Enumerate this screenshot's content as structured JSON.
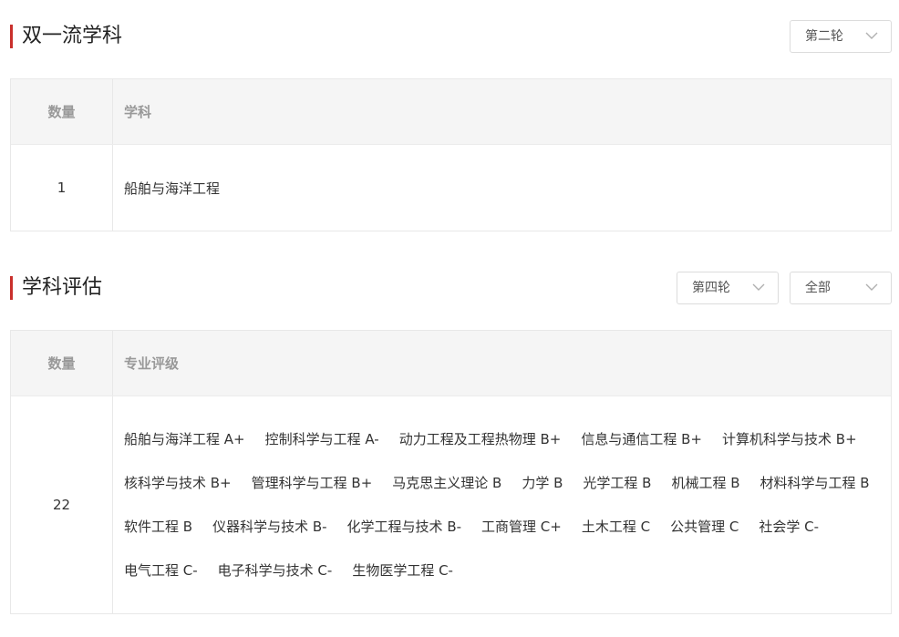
{
  "double_first_class": {
    "title": "双一流学科",
    "round_select": "第二轮",
    "headers": {
      "count": "数量",
      "subject": "学科"
    },
    "row": {
      "count": "1",
      "subject": "船舶与海洋工程"
    }
  },
  "evaluation": {
    "title": "学科评估",
    "round_select": "第四轮",
    "filter_select": "全部",
    "headers": {
      "count": "数量",
      "grade": "专业评级"
    },
    "row": {
      "count": "22",
      "items": [
        "船舶与海洋工程 A+",
        "控制科学与工程 A-",
        "动力工程及工程热物理 B+",
        "信息与通信工程 B+",
        "计算机科学与技术 B+",
        "核科学与技术 B+",
        "管理科学与工程 B+",
        "马克思主义理论 B",
        "力学 B",
        "光学工程 B",
        "机械工程 B",
        "材料科学与工程 B",
        "软件工程 B",
        "仪器科学与技术 B-",
        "化学工程与技术 B-",
        "工商管理 C+",
        "土木工程 C",
        "公共管理 C",
        "社会学 C-",
        "电气工程 C-",
        "电子科学与技术 C-",
        "生物医学工程 C-"
      ]
    }
  },
  "icons": {
    "select_chevron": "chevron-down-icon"
  },
  "colors": {
    "accent": "#c9302c",
    "header_bg": "#f5f5f5",
    "border": "#e8e8e8"
  }
}
